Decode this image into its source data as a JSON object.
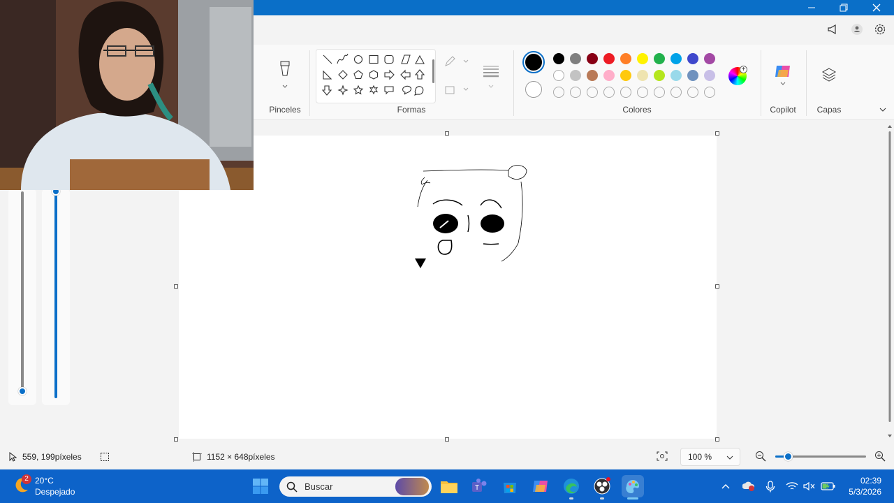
{
  "ribbon": {
    "brushes_label": "Pinceles",
    "shapes_label": "Formas",
    "colors_label": "Colores",
    "copilot_label": "Copilot",
    "layers_label": "Capas"
  },
  "colors": {
    "primary": "#000000",
    "secondary": "#ffffff",
    "row1": [
      "#000000",
      "#7f7f7f",
      "#880015",
      "#ed1c24",
      "#ff7f27",
      "#fff200",
      "#22b14c",
      "#00a2e8",
      "#3f48cc",
      "#a349a4"
    ],
    "row2": [
      "#ffffff",
      "#c3c3c3",
      "#b97a57",
      "#ffaec9",
      "#ffc90e",
      "#efe4b0",
      "#b5e61d",
      "#99d9ea",
      "#7092be",
      "#c8bfe7"
    ]
  },
  "status": {
    "cursor_pos": "559, 199píxeles",
    "canvas_size": "1152 × 648píxeles",
    "zoom": "100 %"
  },
  "taskbar": {
    "notification_badge": "2",
    "weather_temp": "20°C",
    "weather_desc": "Despejado",
    "search_placeholder": "Buscar",
    "time": "02:39",
    "date": "5/3/2026"
  }
}
